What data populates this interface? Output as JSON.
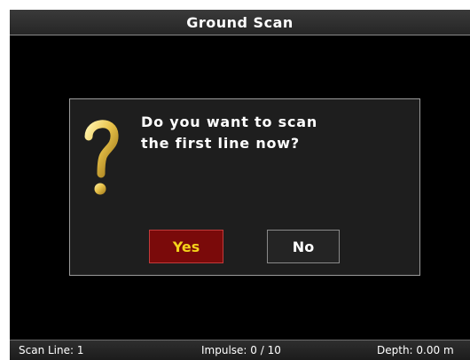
{
  "window": {
    "title": "Ground Scan"
  },
  "dialog": {
    "message": "Do you want to scan\nthe first line now?",
    "icon": "question-mark-icon",
    "yes_label": "Yes",
    "no_label": "No"
  },
  "status": {
    "scan_line": "Scan Line: 1",
    "impulse": "Impulse: 0 / 10",
    "depth": "Depth: 0.00 m"
  },
  "colors": {
    "background": "#000000",
    "dialog_background": "#1e1e1e",
    "icon_gold": "#e8c24a",
    "yes_button_background": "#7a0a0a",
    "yes_button_text": "#f3d21a",
    "no_button_background": "#242424",
    "text": "#ffffff"
  }
}
